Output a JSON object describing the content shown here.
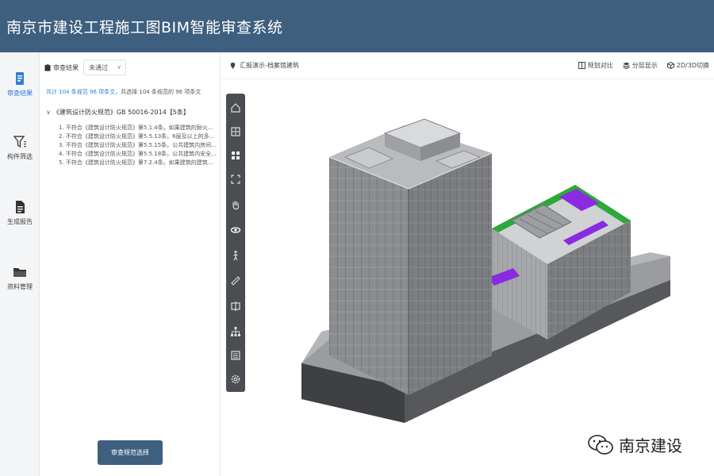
{
  "app": {
    "title": "南京市建设工程施工图BIM智能审查系统"
  },
  "sidebar": {
    "items": [
      {
        "label": "审查结果",
        "icon": "document-icon",
        "active": true
      },
      {
        "label": "构件筛选",
        "icon": "filter-icon",
        "active": false
      },
      {
        "label": "生成报告",
        "icon": "report-icon",
        "active": false
      },
      {
        "label": "资料管理",
        "icon": "folder-icon",
        "active": false
      }
    ]
  },
  "panel": {
    "filter_label": "审查结果",
    "filter_value": "未通过",
    "summary_prefix": "共计 104 条规范 96 项条文，",
    "summary_rest": "共选择 104 条规范的 96 项条文",
    "tree_root": "《建筑设计防火规范》GB 50016-2014【5条】",
    "rules": [
      "1. 不符合《建筑设计防火规范》第5.1.4条。如果建筑的耐火...",
      "2. 不符合《建筑设计防火规范》第5.5.13条。6层及以上的多...",
      "3. 不符合《建筑设计防火规范》第5.5.15条。公共建筑内房间...",
      "4. 不符合《建筑设计防火规范》第5.5.18条。公共建筑内安全...",
      "5. 不符合《建筑设计防火规范》第7.2.4条。如果建筑的建筑..."
    ],
    "button_label": "审查规范选择"
  },
  "topbar": {
    "breadcrumb": "汇报演示-档案馆建筑",
    "tools": [
      {
        "label": "规划对比",
        "icon": "compare-icon"
      },
      {
        "label": "分层显示",
        "icon": "layers-icon"
      },
      {
        "label": "2D/3D切换",
        "icon": "cube-icon"
      }
    ]
  },
  "viewer_tools": [
    "home-icon",
    "box-select-icon",
    "grid-view-icon",
    "fit-view-icon",
    "pan-hand-icon",
    "orbit-icon",
    "walk-icon",
    "measure-icon",
    "section-icon",
    "tree-structure-icon",
    "properties-icon",
    "settings-icon"
  ],
  "watermark": {
    "text": "南京建设",
    "icon": "wechat-icon"
  },
  "colors": {
    "header": "#3f5f7f",
    "accent": "#2f7fd6",
    "model_facade": "#8a8c90",
    "green_roof": "#2ea83a",
    "highlight": "#8a2be2"
  }
}
